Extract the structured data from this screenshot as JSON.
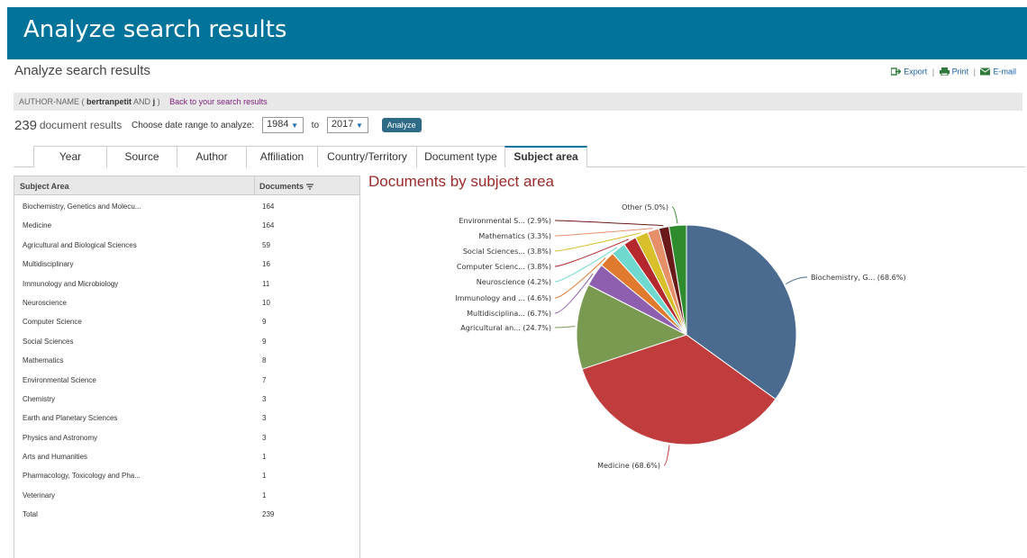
{
  "banner": {
    "title": "Analyze search results"
  },
  "page": {
    "subtitle": "Analyze search results"
  },
  "actions": {
    "export": "Export",
    "print": "Print",
    "email": "E-mail",
    "separator": "|"
  },
  "query": {
    "prefix": "AUTHOR-NAME (",
    "term1": "bertranpetit",
    "and": "AND",
    "term2": "j",
    "suffix": ")",
    "back_link": "Back to your search results"
  },
  "range": {
    "count": "239",
    "count_label": "document results",
    "prompt": "Choose date range to analyze:",
    "from": "1984",
    "to_label": "to",
    "to": "2017",
    "analyze_label": "Analyze"
  },
  "tabs": [
    {
      "label": "Year"
    },
    {
      "label": "Source"
    },
    {
      "label": "Author"
    },
    {
      "label": "Affiliation"
    },
    {
      "label": "Country/Territory"
    },
    {
      "label": "Document type"
    },
    {
      "label": "Subject area",
      "active": true
    }
  ],
  "table": {
    "col_area": "Subject Area",
    "col_docs": "Documents",
    "sort_icon": "sort-icon",
    "rows": [
      {
        "area": "Biochemistry, Genetics and Molecu...",
        "docs": "164"
      },
      {
        "area": "Medicine",
        "docs": "164"
      },
      {
        "area": "Agricultural and Biological Sciences",
        "docs": "59"
      },
      {
        "area": "Multidisciplinary",
        "docs": "16"
      },
      {
        "area": "Immunology and Microbiology",
        "docs": "11"
      },
      {
        "area": "Neuroscience",
        "docs": "10"
      },
      {
        "area": "Computer Science",
        "docs": "9"
      },
      {
        "area": "Social Sciences",
        "docs": "9"
      },
      {
        "area": "Mathematics",
        "docs": "8"
      },
      {
        "area": "Environmental Science",
        "docs": "7"
      },
      {
        "area": "Chemistry",
        "docs": "3"
      },
      {
        "area": "Earth and Planetary Sciences",
        "docs": "3"
      },
      {
        "area": "Physics and Astronomy",
        "docs": "3"
      },
      {
        "area": "Arts and Humanities",
        "docs": "1"
      },
      {
        "area": "Pharmacology, Toxicology and Pha...",
        "docs": "1"
      },
      {
        "area": "Veterinary",
        "docs": "1"
      },
      {
        "area": "Total",
        "docs": "239"
      }
    ]
  },
  "colors": {
    "banner": "#00739a",
    "chart_title": "#9b2a2a",
    "link": "#7b1e7a",
    "button": "#2e6b86"
  },
  "chart_data": {
    "type": "pie",
    "title": "Documents by subject area",
    "slices": [
      {
        "name": "Biochemistry, G...",
        "pct_label": "68.6%",
        "value": 164,
        "color": "#4a6b8f",
        "label_side": "right"
      },
      {
        "name": "Medicine",
        "pct_label": "68.6%",
        "value": 164,
        "color": "#c13c3c",
        "label_side": "bottom"
      },
      {
        "name": "Agricultural an...",
        "pct_label": "24.7%",
        "value": 59,
        "color": "#7a9a52",
        "label_side": "left"
      },
      {
        "name": "Multidisciplina...",
        "pct_label": "6.7%",
        "value": 16,
        "color": "#8e5fae",
        "label_side": "left"
      },
      {
        "name": "Immunology and ...",
        "pct_label": "4.6%",
        "value": 11,
        "color": "#e07a2e",
        "label_side": "left"
      },
      {
        "name": "Neuroscience",
        "pct_label": "4.2%",
        "value": 10,
        "color": "#6fd8cf",
        "label_side": "left"
      },
      {
        "name": "Computer Scienc...",
        "pct_label": "3.8%",
        "value": 9,
        "color": "#b5282e",
        "label_side": "left"
      },
      {
        "name": "Social Sciences...",
        "pct_label": "3.8%",
        "value": 9,
        "color": "#d9bf2a",
        "label_side": "left"
      },
      {
        "name": "Mathematics",
        "pct_label": "3.3%",
        "value": 8,
        "color": "#e6906a",
        "label_side": "left"
      },
      {
        "name": "Environmental S...",
        "pct_label": "2.9%",
        "value": 7,
        "color": "#6b1a1a",
        "label_side": "left"
      },
      {
        "name": "Other",
        "pct_label": "5.0%",
        "value": 12,
        "color": "#2e8b2e",
        "label_side": "top"
      }
    ]
  }
}
